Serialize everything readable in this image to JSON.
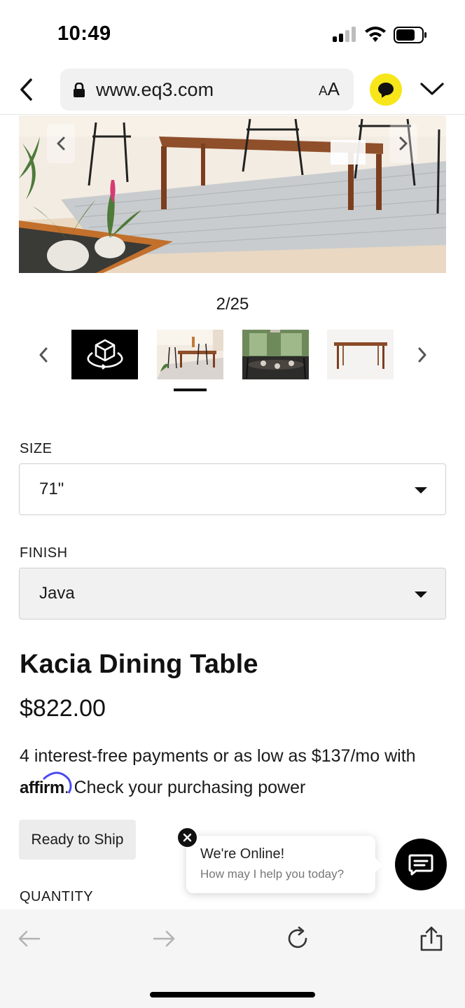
{
  "status_bar": {
    "time": "10:49"
  },
  "browser": {
    "url": "www.eq3.com",
    "text_size_label_small": "A",
    "text_size_label_large": "A"
  },
  "gallery": {
    "counter": "2/25",
    "current_index": 2,
    "total": 25,
    "thumbnails": [
      {
        "name": "3d-view"
      },
      {
        "name": "dining-room-bright"
      },
      {
        "name": "dining-room-set"
      },
      {
        "name": "table-product-shot"
      }
    ]
  },
  "options": {
    "size": {
      "label": "SIZE",
      "value": "71\""
    },
    "finish": {
      "label": "FINISH",
      "value": "Java"
    }
  },
  "product": {
    "title": "Kacia Dining Table",
    "price": "$822.00",
    "financing_text": "4 interest-free payments or as low as $137/mo with",
    "affirm_logo": "affirm",
    "financing_link": ". Check your purchasing power",
    "availability": "Ready to Ship",
    "quantity_label": "QUANTITY"
  },
  "chat": {
    "title": "We're Online!",
    "subtitle": "How may I help you today?"
  },
  "colors": {
    "extension_icon": "#f7e61a",
    "affirm_arc": "#4a4af4",
    "toolbar_bg": "#f5f5f5"
  }
}
